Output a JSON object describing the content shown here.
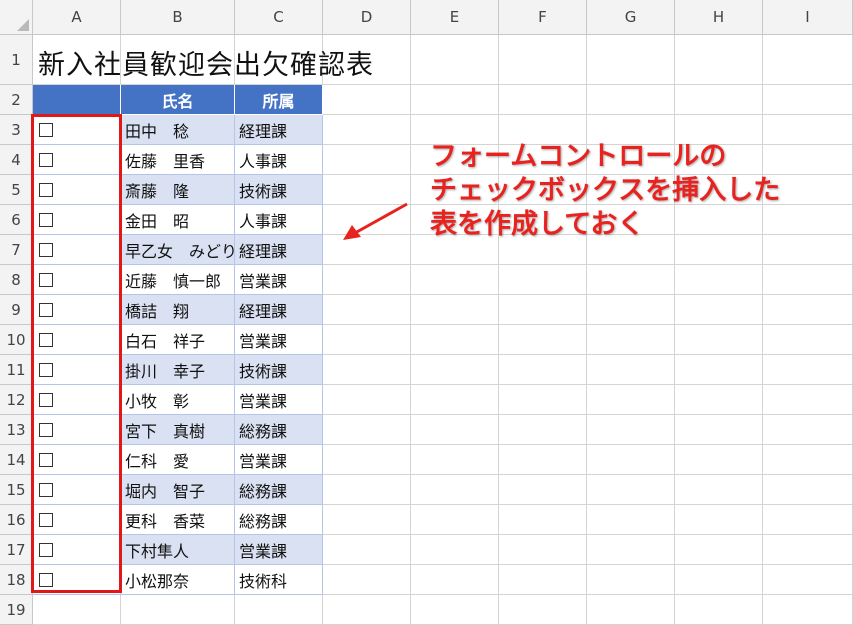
{
  "columns": [
    "A",
    "B",
    "C",
    "D",
    "E",
    "F",
    "G",
    "H",
    "I"
  ],
  "rows": [
    "1",
    "2",
    "3",
    "4",
    "5",
    "6",
    "7",
    "8",
    "9",
    "10",
    "11",
    "12",
    "13",
    "14",
    "15",
    "16",
    "17",
    "18",
    "19"
  ],
  "title": "新入社員歓迎会出欠確認表",
  "table": {
    "headers": {
      "name": "氏名",
      "dept": "所属"
    },
    "entries": [
      {
        "name": "田中　稔",
        "dept": "経理課"
      },
      {
        "name": "佐藤　里香",
        "dept": "人事課"
      },
      {
        "name": "斎藤　隆",
        "dept": "技術課"
      },
      {
        "name": "金田　昭",
        "dept": "人事課"
      },
      {
        "name": "早乙女　みどり",
        "dept": "経理課"
      },
      {
        "name": "近藤　慎一郎",
        "dept": "営業課"
      },
      {
        "name": "橋詰　翔",
        "dept": "経理課"
      },
      {
        "name": "白石　祥子",
        "dept": "営業課"
      },
      {
        "name": "掛川　幸子",
        "dept": "技術課"
      },
      {
        "name": "小牧　彰",
        "dept": "営業課"
      },
      {
        "name": "宮下　真樹",
        "dept": "総務課"
      },
      {
        "name": "仁科　愛",
        "dept": "営業課"
      },
      {
        "name": "堀内　智子",
        "dept": "総務課"
      },
      {
        "name": "更科　香菜",
        "dept": "総務課"
      },
      {
        "name": "下村隼人",
        "dept": "営業課"
      },
      {
        "name": "小松那奈",
        "dept": "技術科"
      }
    ]
  },
  "callout": {
    "lines": [
      "フォームコントロールの",
      "チェックボックスを挿入した",
      "表を作成しておく"
    ]
  },
  "colors": {
    "header_fill": "#4472c4",
    "band_fill": "#d9e1f2",
    "highlight": "#e01818",
    "callout_text": "#e8231f"
  }
}
